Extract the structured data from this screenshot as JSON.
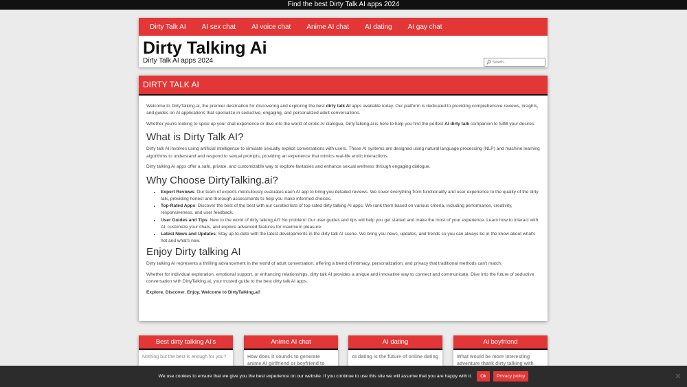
{
  "topbar": {
    "text": "Find the best Dirty Talk AI apps 2024"
  },
  "nav": {
    "items": [
      "Dirty Talk AI",
      "AI sex chat",
      "AI voice chat",
      "Anime AI chat",
      "AI dating",
      "AI gay chat"
    ]
  },
  "site": {
    "title": "Dirty Talking Ai",
    "tagline": "Dirty Talk AI apps 2024",
    "search_placeholder": "Search..."
  },
  "main": {
    "heading": "DIRTY TALK AI",
    "intro1_pre": "Welcome to DirtyTalking.ai, the premier destination for discovering and exploring the best ",
    "intro1_bold": "dirty talk AI",
    "intro1_post": " apps available today. Our platform is dedicated to providing comprehensive reviews, insights, and guides on AI applications that specialize in seductive, engaging, and personalized adult conversations.",
    "intro2_pre": "Whether you're looking to spice up your chat experience or dive into the world of erotic AI dialogue, DirtyTalking.ai is here to help you find the perfect ",
    "intro2_bold": "AI dirty talk",
    "intro2_post": " companion to fulfill your desires.",
    "h_what": "What is Dirty Talk AI?",
    "what1": "Dirty talk AI involves using artificial intelligence to simulate sexually explicit conversations with users. These AI systems are designed using natural language processing (NLP) and machine learning algorithms to understand and respond to sexual prompts, providing an experience that mimics real-life erotic interactions.",
    "what2": "Dirty talking AI apps offer a safe, private, and customizable way to explore fantasies and enhance sexual wellness through engaging dialogue.",
    "h_why": "Why Choose DirtyTalking.ai?",
    "why_items": [
      {
        "title": "Expert Reviews",
        "text": ": Our team of experts meticulously evaluates each AI app to bring you detailed reviews. We cover everything from functionality and user experience to the quality of the dirty talk, providing honest and thorough assessments to help you make informed choices."
      },
      {
        "title": "Top-Rated Apps",
        "text": ": Discover the best of the best with our curated lists of top-rated dirty talking AI apps. We rank them based on various criteria, including performance, creativity, responsiveness, and user feedback."
      },
      {
        "title": "User Guides and Tips",
        "text": ": New to the world of dirty talking AI? No problem! Our user guides and tips will help you get started and make the most of your experience. Learn how to interact with AI, customize your chats, and explore advanced features for maximum pleasure."
      },
      {
        "title": "Latest News and Updates",
        "text": ": Stay up-to-date with the latest developments in the dirty talk AI scene. We bring you news, updates, and trends so you can always be in the know about what's hot and what's new."
      }
    ],
    "h_enjoy": "Enjoy Dirty talking AI",
    "enjoy1": "Dirty talking AI represents a thrilling advancement in the world of adult conversation, offering a blend of intimacy, personalization, and privacy that traditional methods can't match.",
    "enjoy2": "Whether for individual exploration, emotional support, or enhancing relationships, dirty talk AI provides a unique and innovative way to connect and communicate. Dive into the future of seductive conversation with DirtyTalking.ai, your trusted guide to the best dirty talk AI apps.",
    "closing": "Explore. Discover. Enjoy. Welcome to DirtyTalking.ai!"
  },
  "cards": [
    {
      "title": "Best dirty talking AI's",
      "text": "Nothing but the best is enough for you?"
    },
    {
      "title": "Anime AI chat",
      "text": "How does it sounds to generate anime AI girlfriend or boyfriend to"
    },
    {
      "title": "AI dating",
      "text": "AI dating is the future of online dating"
    },
    {
      "title": "Ai boyfriend",
      "text": "What would be more interesting adventure thank dirty talking with"
    }
  ],
  "cookie": {
    "text": "We use cookies to ensure that we give you the best experience on our website. If you continue to use this site we will assume that you are happy with it.",
    "ok_label": "Ok",
    "privacy_label": "Privacy policy"
  },
  "colors": {
    "accent": "#e33636",
    "topbar": "#111111",
    "cookie_bar": "#2c2c2c",
    "page_bg": "#ebebeb"
  }
}
